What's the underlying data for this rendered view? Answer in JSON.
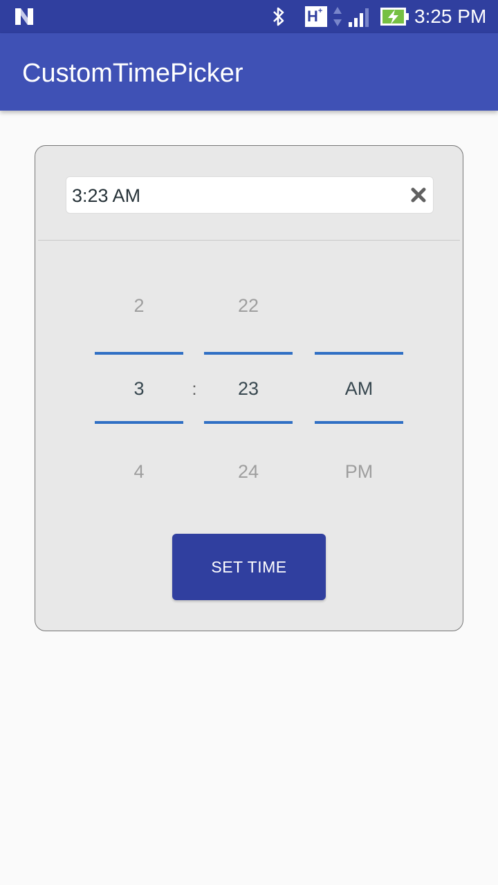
{
  "status_bar": {
    "time": "3:25 PM",
    "network_type": "H",
    "network_superscript": "+",
    "icons": [
      "android-n-icon",
      "bluetooth-icon",
      "hplus-icon",
      "data-arrows-icon",
      "signal-icon",
      "battery-charging-icon"
    ]
  },
  "app_bar": {
    "title": "CustomTimePicker",
    "color": "#3f51b5"
  },
  "time_picker": {
    "input_value": "3:23 AM",
    "clear_icon": "close-icon",
    "separator": ":",
    "hour": {
      "prev": "2",
      "selected": "3",
      "next": "4"
    },
    "minute": {
      "prev": "22",
      "selected": "23",
      "next": "24"
    },
    "ampm": {
      "prev": "",
      "selected": "AM",
      "next": "PM"
    },
    "set_button_label": "SET TIME",
    "accent_color": "#2f6fc4",
    "button_color": "#303f9f"
  }
}
